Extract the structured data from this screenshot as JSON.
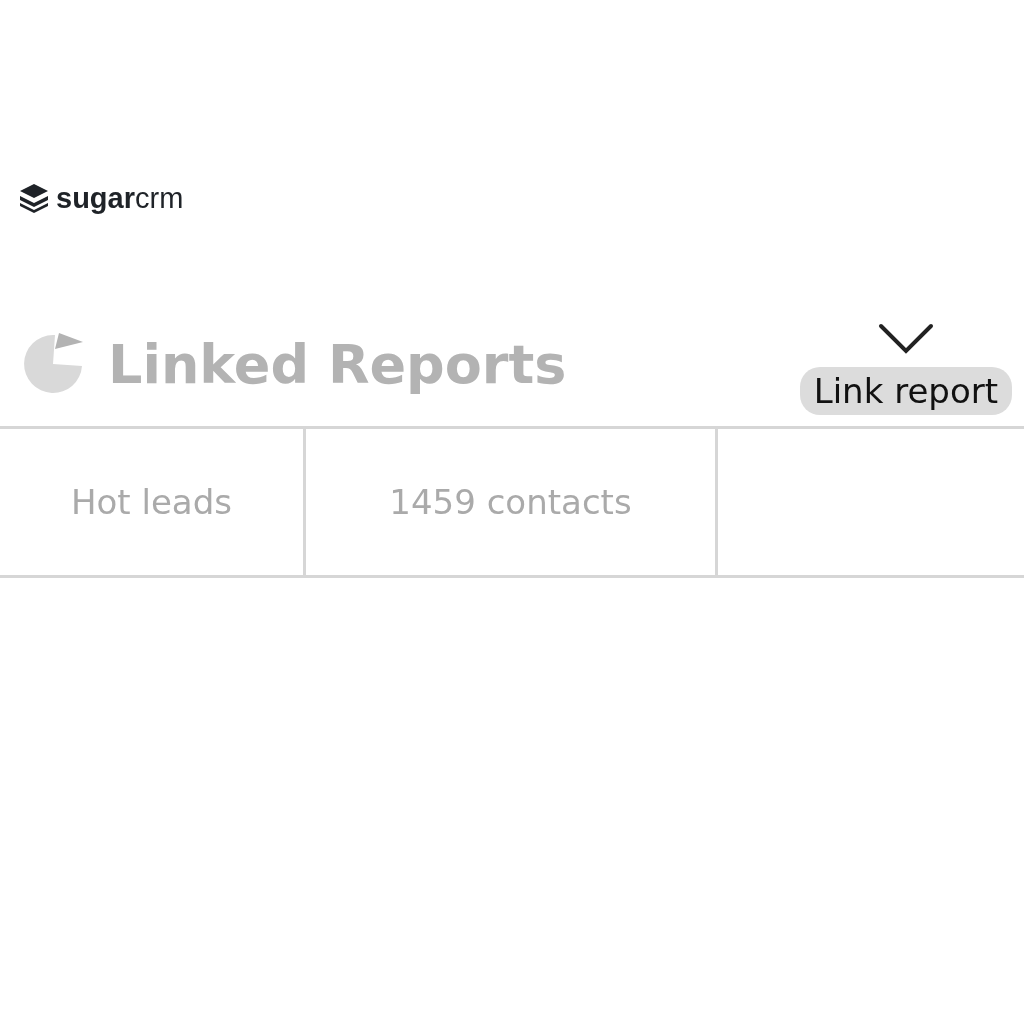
{
  "logo": {
    "text": "**sugar**crm"
  },
  "header": {
    "title": "Linked Reports",
    "button": "Link report"
  },
  "table": {
    "rows": [
      {
        "cells": [
          "Hot leads",
          "1459 contacts"
        ]
      }
    ]
  }
}
